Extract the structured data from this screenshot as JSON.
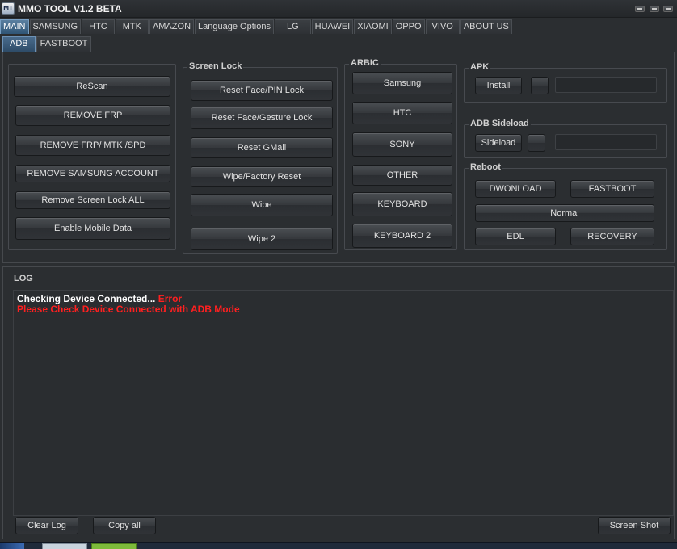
{
  "window": {
    "title": "MMO TOOL V1.2 BETA",
    "icon_text": "MT",
    "icon": "app-logo-icon"
  },
  "main_tabs": [
    {
      "label": "MAIN",
      "active": true
    },
    {
      "label": "SAMSUNG"
    },
    {
      "label": "HTC"
    },
    {
      "label": "MTK"
    },
    {
      "label": "AMAZON"
    },
    {
      "label": "Language Options"
    },
    {
      "label": "LG"
    },
    {
      "label": "HUAWEI"
    },
    {
      "label": "XIAOMI"
    },
    {
      "label": "OPPO"
    },
    {
      "label": "VIVO"
    },
    {
      "label": "ABOUT US"
    }
  ],
  "sub_tabs": [
    {
      "label": "ADB",
      "active": true
    },
    {
      "label": "FASTBOOT"
    }
  ],
  "general_buttons": [
    "ReScan",
    "REMOVE FRP",
    "REMOVE FRP/ MTK /SPD",
    "REMOVE SAMSUNG ACCOUNT",
    "Remove Screen Lock ALL",
    "Enable Mobile Data"
  ],
  "screen_lock": {
    "title": "Screen Lock",
    "buttons": [
      "Reset Face/PIN Lock",
      "Reset Face/Gesture Lock",
      "Reset GMail",
      "Wipe/Factory Reset",
      "Wipe",
      "Wipe 2"
    ]
  },
  "arbic": {
    "title": "ARBIC",
    "buttons": [
      "Samsung",
      "HTC",
      "SONY",
      "OTHER",
      "KEYBOARD",
      "KEYBOARD 2"
    ]
  },
  "apk": {
    "title": "APK",
    "install_label": "Install",
    "path_value": ""
  },
  "sideload": {
    "title": "ADB Sideload",
    "sideload_label": "Sideload",
    "path_value": ""
  },
  "reboot": {
    "title": "Reboot",
    "dwonload": "DWONLOAD",
    "fastboot": "FASTBOOT",
    "normal": "Normal",
    "edl": "EDL",
    "recovery": "RECOVERY"
  },
  "log": {
    "title": "LOG",
    "line1_prefix": "Checking Device Connected... ",
    "line1_status": "Error",
    "line2": "Please Check Device Connected with ADB Mode",
    "clear_label": "Clear Log",
    "copy_label": "Copy all",
    "screenshot_label": "Screen Shot"
  },
  "colors": {
    "error": "#ff2020",
    "active_tab": "#3f6f99",
    "background": "#2b2e31"
  }
}
